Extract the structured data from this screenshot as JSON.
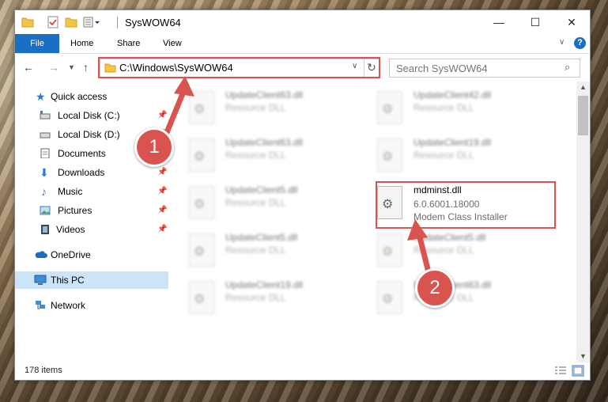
{
  "window": {
    "title": "SysWOW64",
    "controls": {
      "minimize": "—",
      "maximize": "☐",
      "close": "✕"
    }
  },
  "ribbon": {
    "tabs": [
      "File",
      "Home",
      "Share",
      "View"
    ]
  },
  "address_bar": {
    "path": "C:\\Windows\\SysWOW64",
    "search_placeholder": "Search SysWOW64"
  },
  "sidebar": {
    "items": [
      {
        "label": "Quick access",
        "icon": "star-icon",
        "pinned": false
      },
      {
        "label": "Local Disk (C:)",
        "icon": "drive-icon",
        "pinned": true
      },
      {
        "label": "Local Disk (D:)",
        "icon": "drive-icon",
        "pinned": true
      },
      {
        "label": "Documents",
        "icon": "documents-icon",
        "pinned": true
      },
      {
        "label": "Downloads",
        "icon": "download-icon",
        "pinned": true
      },
      {
        "label": "Music",
        "icon": "music-icon",
        "pinned": true
      },
      {
        "label": "Pictures",
        "icon": "pictures-icon",
        "pinned": true
      },
      {
        "label": "Videos",
        "icon": "videos-icon",
        "pinned": true
      },
      {
        "label": "OneDrive",
        "icon": "cloud-icon",
        "pinned": false
      },
      {
        "label": "This PC",
        "icon": "computer-icon",
        "pinned": false,
        "selected": true
      },
      {
        "label": "Network",
        "icon": "network-icon",
        "pinned": false
      }
    ]
  },
  "files": [
    {
      "name": "UpdateClient63.dll",
      "type": "Resource DLL"
    },
    {
      "name": "UpdateClient42.dll",
      "type": "Resource DLL"
    },
    {
      "name": "UpdateClient63.dll",
      "type": "Resource DLL"
    },
    {
      "name": "UpdateClient19.dll",
      "type": "Resource DLL"
    },
    {
      "name": "UpdateClient5.dll",
      "type": "Resource DLL"
    },
    {
      "name": "mdminst.dll",
      "version": "6.0.6001.18000",
      "description": "Modem Class Installer",
      "highlighted": true
    },
    {
      "name": "UpdateClient5.dll",
      "type": "Resource DLL"
    },
    {
      "name": "UpdateClient5.dll",
      "type": "Resource DLL"
    },
    {
      "name": "UpdateClient19.dll",
      "type": "Resource DLL"
    },
    {
      "name": "UpdateClient63.dll",
      "type": "Resource DLL"
    }
  ],
  "status_bar": {
    "item_count": "178 items"
  },
  "callouts": {
    "step1": "1",
    "step2": "2"
  },
  "colors": {
    "accent": "#1a6fc2",
    "callout": "#d9534f",
    "selected": "#cce4f7"
  }
}
